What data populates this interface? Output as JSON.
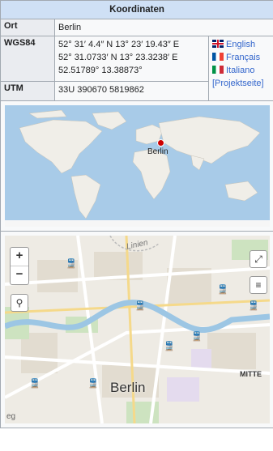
{
  "header": {
    "title": "Koordinaten"
  },
  "rows": {
    "ort": {
      "label": "Ort",
      "value": "Berlin"
    },
    "wgs84": {
      "label": "WGS84",
      "dms": "52° 31′ 4.4″ N 13° 23′ 19.43″ E",
      "dm": "52° 31.0733′ N 13° 23.3238′ E",
      "dec": "52.51789° 13.38873°"
    },
    "utm": {
      "label": "UTM",
      "value": "33U 390670 5819862"
    }
  },
  "languages": [
    {
      "label": "English",
      "flag": "flag-uk-icon"
    },
    {
      "label": "Français",
      "flag": "flag-fr-icon"
    },
    {
      "label": "Italiano",
      "flag": "flag-it-icon"
    }
  ],
  "project_link": "[Projektseite]",
  "world_map": {
    "marker_label": "Berlin",
    "marker_color": "#cc0000"
  },
  "city_map": {
    "zoom_in": "+",
    "zoom_out": "−",
    "labels": {
      "berlin": "Berlin",
      "mitte": "MITTE",
      "street": "Linien",
      "corner": "eg"
    }
  }
}
